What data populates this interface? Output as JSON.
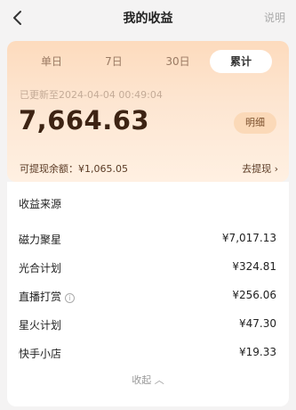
{
  "header": {
    "title": "我的收益",
    "help": "说明",
    "back_icon": "chevron-left-icon"
  },
  "card": {
    "tabs": [
      "单日",
      "7日",
      "30日",
      "累计"
    ],
    "active_tab": "累计",
    "updated": "已更新至2024-04-04 00:49:04",
    "total": "7,664.63",
    "detail_button": "明细",
    "withdrawable": "可提现余额：¥1,065.05",
    "withdraw_link": "去提现 ›"
  },
  "sources": {
    "title": "收益来源",
    "items": [
      {
        "label": "磁力聚星",
        "value": "¥7,017.13"
      },
      {
        "label": "光合计划",
        "value": "¥324.81"
      },
      {
        "label": "直播打赏",
        "value": "¥256.06"
      },
      {
        "label": "星火计划",
        "value": "¥47.30"
      },
      {
        "label": "快手小店",
        "value": "¥19.33"
      }
    ],
    "collapse": "收起 ︿"
  },
  "colors": {
    "amount": "#3d2313",
    "card_gradient_top": "#fddbbd",
    "card_gradient_bottom": "#fff0e2"
  }
}
